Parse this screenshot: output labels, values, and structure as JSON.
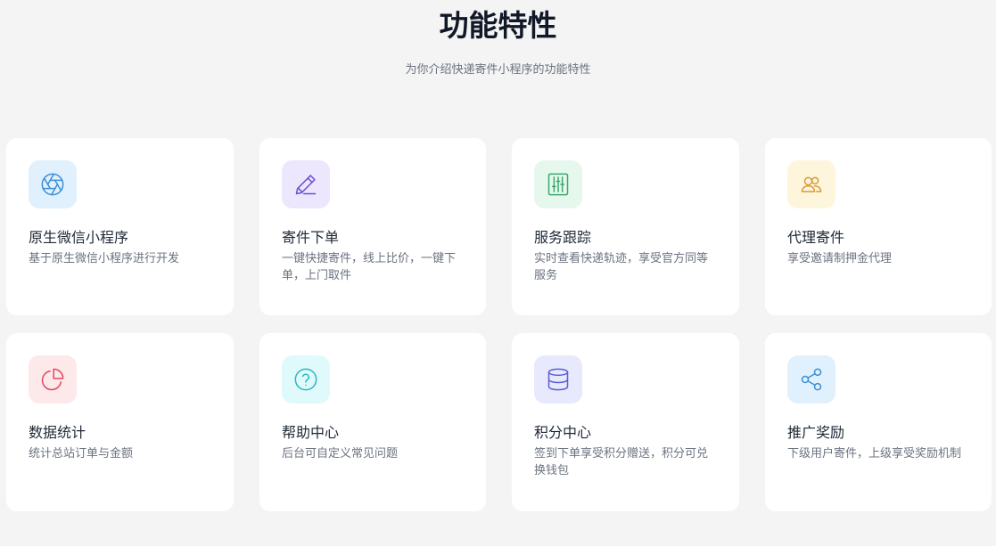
{
  "header": {
    "title": "功能特性",
    "subtitle": "为你介绍快递寄件小程序的功能特性"
  },
  "features": [
    {
      "title": "原生微信小程序",
      "desc": "基于原生微信小程序进行开发",
      "icon": "aperture-icon",
      "icon_color": "#3b8fd6",
      "icon_bg": "#e0f1fd"
    },
    {
      "title": "寄件下单",
      "desc": "一键快捷寄件，线上比价，一键下单，上门取件",
      "icon": "pencil-icon",
      "icon_color": "#6d4fd8",
      "icon_bg": "#ede7fd"
    },
    {
      "title": "服务跟踪",
      "desc": "实时查看快递轨迹，享受官方同等服务",
      "icon": "sliders-icon",
      "icon_color": "#3aa86b",
      "icon_bg": "#e6f8ee"
    },
    {
      "title": "代理寄件",
      "desc": "享受邀请制押金代理",
      "icon": "users-icon",
      "icon_color": "#d99a3a",
      "icon_bg": "#fdf6dd"
    },
    {
      "title": "数据统计",
      "desc": "统计总站订单与金额",
      "icon": "pie-chart-icon",
      "icon_color": "#e0485e",
      "icon_bg": "#fde8ea"
    },
    {
      "title": "帮助中心",
      "desc": "后台可自定义常见问题",
      "icon": "help-circle-icon",
      "icon_color": "#2ab7c4",
      "icon_bg": "#e0fafb"
    },
    {
      "title": "积分中心",
      "desc": "签到下单享受积分赠送，积分可兑换钱包",
      "icon": "database-icon",
      "icon_color": "#5b5fd8",
      "icon_bg": "#e8e9fc"
    },
    {
      "title": "推广奖励",
      "desc": "下级用户寄件，上级享受奖励机制",
      "icon": "share-icon",
      "icon_color": "#3b8fd6",
      "icon_bg": "#e0f1fd"
    }
  ]
}
